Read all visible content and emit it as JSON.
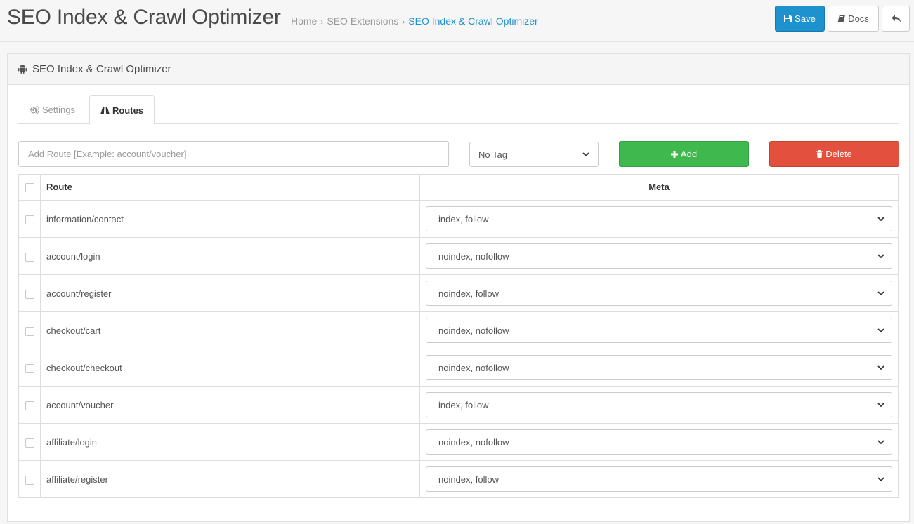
{
  "header": {
    "title": "SEO Index & Crawl Optimizer",
    "breadcrumb": [
      "Home",
      "SEO Extensions",
      "SEO Index & Crawl Optimizer"
    ],
    "save_label": "Save",
    "docs_label": "Docs"
  },
  "panel": {
    "title": "SEO Index & Crawl Optimizer"
  },
  "tabs": [
    {
      "label": "Settings",
      "icon": "cogs-icon",
      "active": false
    },
    {
      "label": "Routes",
      "icon": "road-icon",
      "active": true
    }
  ],
  "toolbar": {
    "route_placeholder": "Add Route [Example: account/voucher]",
    "tag_value": "No Tag",
    "add_label": "Add",
    "delete_label": "Delete"
  },
  "table": {
    "headers": {
      "route": "Route",
      "meta": "Meta"
    },
    "rows": [
      {
        "route": "information/contact",
        "meta": "index, follow"
      },
      {
        "route": "account/login",
        "meta": "noindex, nofollow"
      },
      {
        "route": "account/register",
        "meta": "noindex, follow"
      },
      {
        "route": "checkout/cart",
        "meta": "noindex, nofollow"
      },
      {
        "route": "checkout/checkout",
        "meta": "noindex, nofollow"
      },
      {
        "route": "account/voucher",
        "meta": "index, follow"
      },
      {
        "route": "affiliate/login",
        "meta": "noindex, nofollow"
      },
      {
        "route": "affiliate/register",
        "meta": "noindex, follow"
      }
    ]
  },
  "colors": {
    "primary": "#1e91cf",
    "success": "#3fb94d",
    "danger": "#e3503e"
  }
}
